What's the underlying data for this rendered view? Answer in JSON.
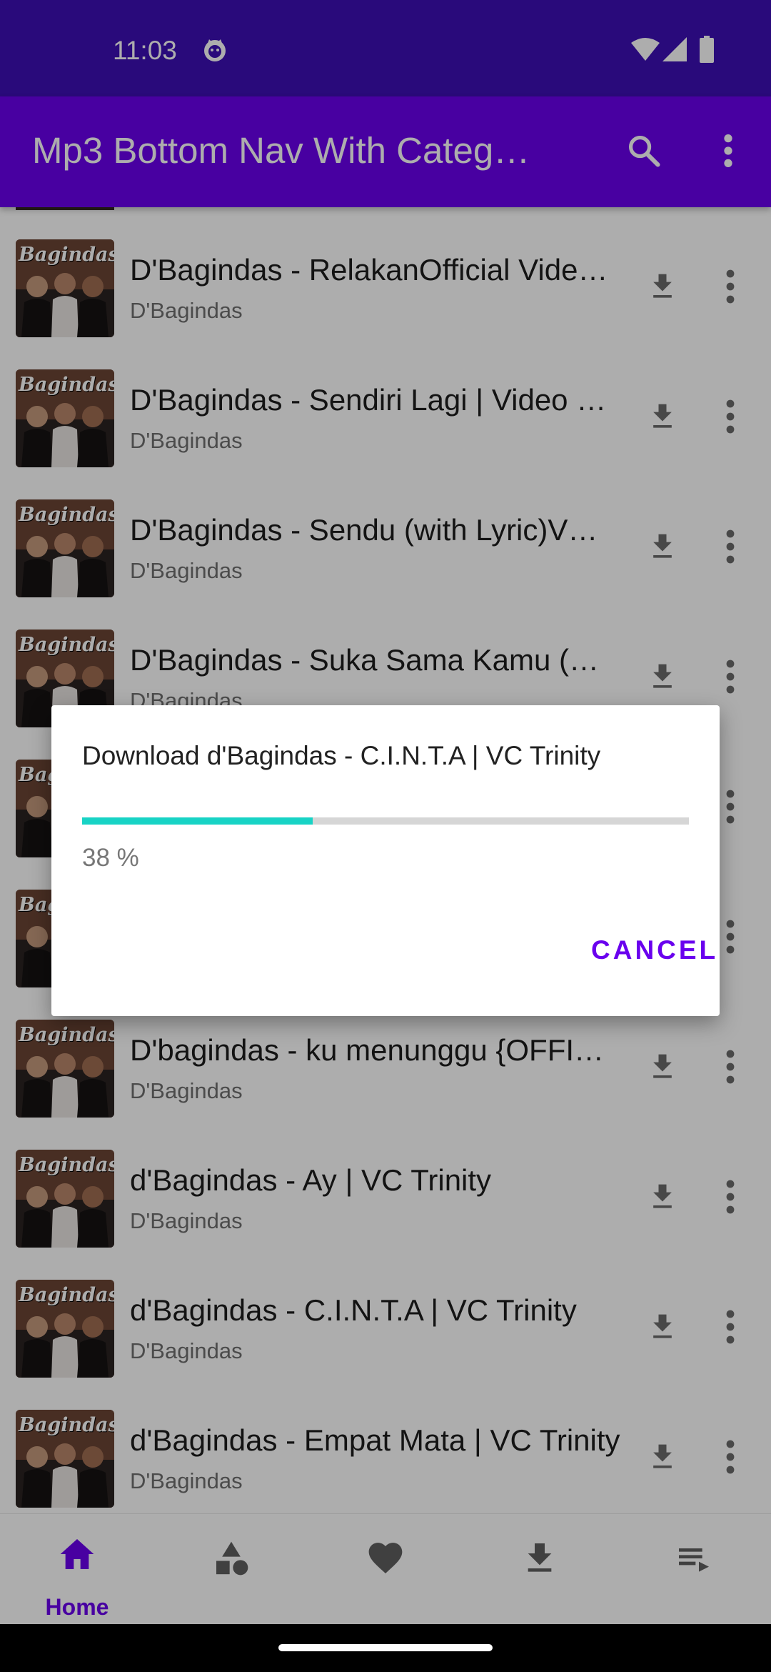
{
  "status_bar": {
    "time": "11:03",
    "icons": [
      "cat-face-notification-icon",
      "wifi-icon",
      "cellular-signal-icon",
      "battery-icon"
    ]
  },
  "app_bar": {
    "title": "Mp3 Bottom Nav With Categ…",
    "actions": [
      "search-icon",
      "more-vert-icon"
    ]
  },
  "colors": {
    "status_bar": "#3d0fb5",
    "app_bar": "#6a00ee",
    "accent": "#6a00ee",
    "progress": "#18d3c5"
  },
  "thumbnail_logo": "Bagindas",
  "songs": [
    {
      "title": "D'Bagindas - RelakanOfficial Vide…",
      "artist": "D'Bagindas"
    },
    {
      "title": "D'Bagindas - Sendiri Lagi | Video …",
      "artist": "D'Bagindas"
    },
    {
      "title": "D'Bagindas - Sendu (with Lyric)V…",
      "artist": "D'Bagindas"
    },
    {
      "title": "D'Bagindas - Suka Sama Kamu (…",
      "artist": "D'Bagindas"
    },
    {
      "title": "",
      "artist": ""
    },
    {
      "title": "",
      "artist": ""
    },
    {
      "title": "D'bagindas - ku menunggu {OFFI…",
      "artist": "D'Bagindas"
    },
    {
      "title": "d'Bagindas - Ay | VC Trinity",
      "artist": "D'Bagindas"
    },
    {
      "title": "d'Bagindas - C.I.N.T.A | VC Trinity",
      "artist": "D'Bagindas"
    },
    {
      "title": "d'Bagindas - Empat Mata | VC Trinity",
      "artist": "D'Bagindas"
    }
  ],
  "dialog": {
    "title": "Download d'Bagindas - C.I.N.T.A | VC Trinity",
    "progress_percent": 38,
    "progress_text": "38 %",
    "cancel_label": "CANCEL"
  },
  "bottom_nav": {
    "items": [
      {
        "label": "Home",
        "icon": "home-icon",
        "active": true
      },
      {
        "label": "",
        "icon": "category-icon",
        "active": false
      },
      {
        "label": "",
        "icon": "favorite-icon",
        "active": false
      },
      {
        "label": "",
        "icon": "download-icon",
        "active": false
      },
      {
        "label": "",
        "icon": "playlist-icon",
        "active": false
      }
    ]
  }
}
